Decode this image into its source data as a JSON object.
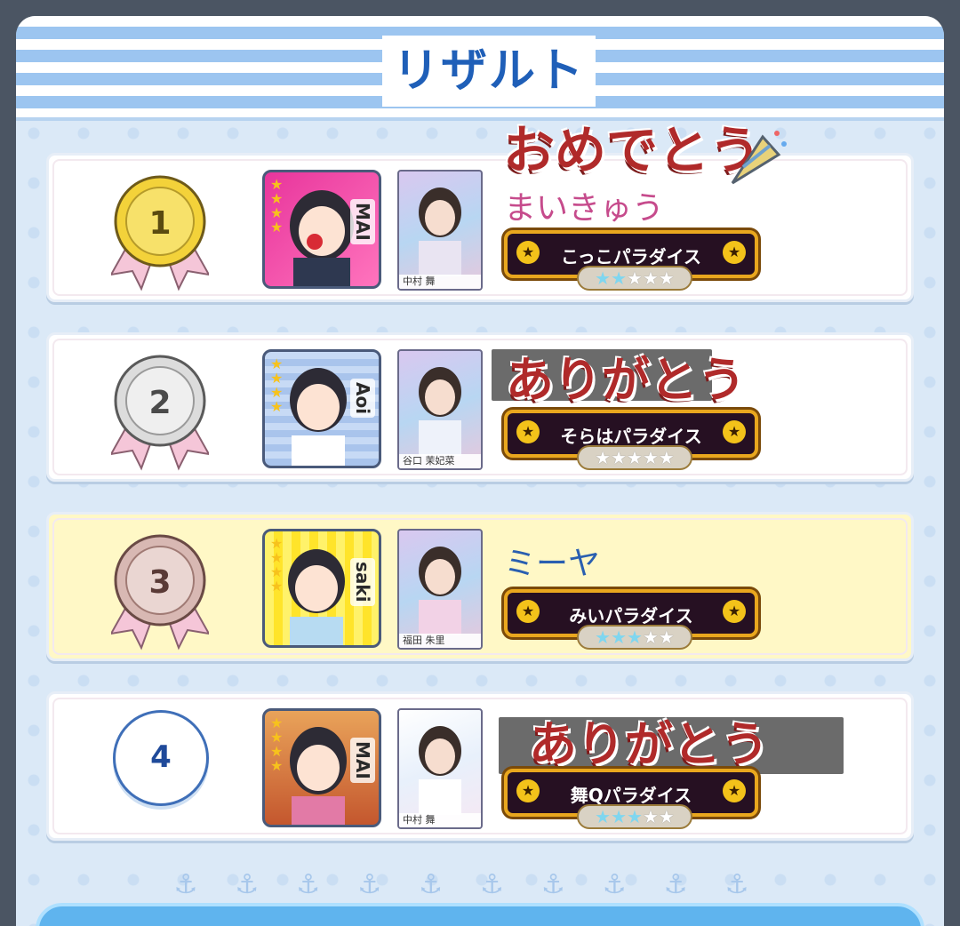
{
  "header": {
    "title": "リザルト"
  },
  "stickers": {
    "omedetou": "おめでとう",
    "arigatou": "ありがとう"
  },
  "results": [
    {
      "rank": "1",
      "name": "まいきゅう",
      "team": "こっこパラダイス",
      "photo_caption": "中村 舞",
      "avatar_name": "MAI",
      "stars_on": 2
    },
    {
      "rank": "2",
      "name": "",
      "team": "そらはパラダイス",
      "photo_caption": "谷口 茉妃菜",
      "avatar_name": "Aoi",
      "stars_on": 0
    },
    {
      "rank": "3",
      "name": "ミーヤ",
      "team": "みいパラダイス",
      "photo_caption": "福田 朱里",
      "avatar_name": "saki",
      "stars_on": 3
    },
    {
      "rank": "4",
      "name": "",
      "team": "舞Qパラダイス",
      "photo_caption": "中村 舞",
      "avatar_name": "MAI",
      "stars_on": 3
    }
  ],
  "colors": {
    "medal_gold": "#f3d23a",
    "medal_silver": "#dcdcdc",
    "medal_bronze": "#d8b8b3",
    "highlight_row": "#fff8c6"
  }
}
